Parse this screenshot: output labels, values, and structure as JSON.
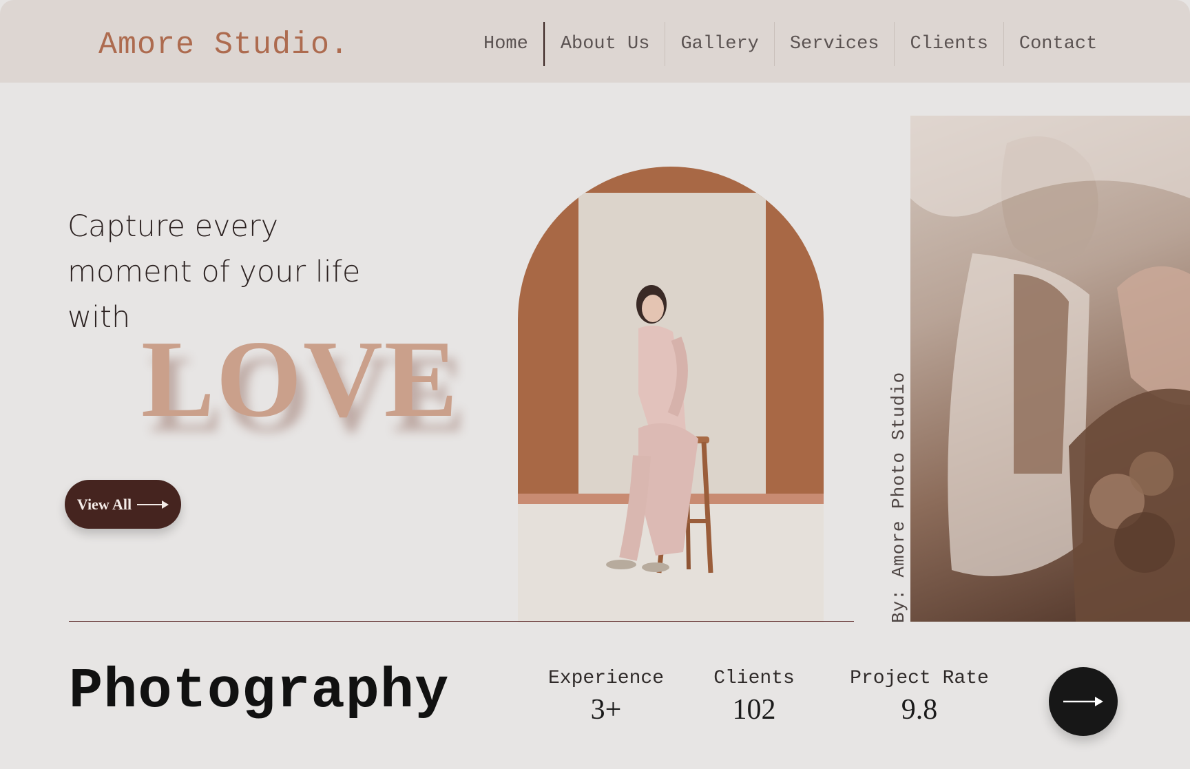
{
  "header": {
    "brand": "Amore Studio.",
    "nav": [
      "Home",
      "About Us",
      "Gallery",
      "Services",
      "Clients",
      "Contact"
    ]
  },
  "hero": {
    "lines": [
      "Capture every",
      "moment of your life",
      "with"
    ],
    "highlight": "LOVE",
    "button_label": "View All",
    "vertical_caption": "By: Amore Photo Studio"
  },
  "footer": {
    "title": "Photography",
    "stats": [
      {
        "label": "Experience",
        "value": "3+"
      },
      {
        "label": "Clients",
        "value": "102"
      },
      {
        "label": "Project Rate",
        "value": "9.8"
      }
    ]
  },
  "colors": {
    "background": "#e7e5e4",
    "header_bg": "#ddd6d2",
    "brand": "#ad6b4f",
    "love": "#caa08b",
    "button_dark": "#45241f",
    "circle_button": "#171717"
  },
  "icons": {
    "arrow": "arrow-right-icon"
  }
}
